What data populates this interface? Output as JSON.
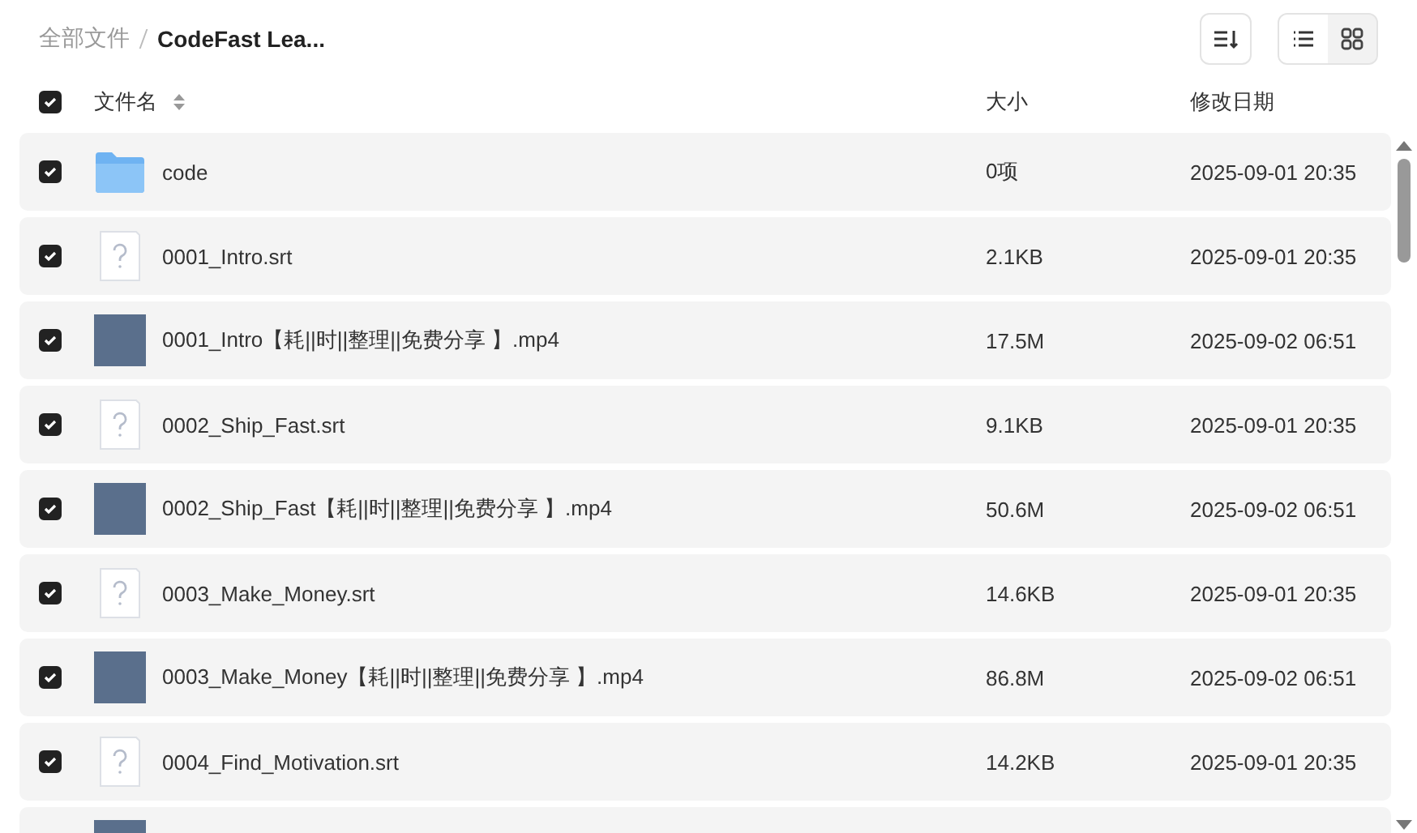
{
  "breadcrumb": [
    {
      "label": "全部文件",
      "current": false
    },
    {
      "label": "CodeFast Lea...",
      "current": true
    }
  ],
  "view_toggle": [
    {
      "kind": "list",
      "selected": true
    },
    {
      "kind": "grid",
      "selected": false
    }
  ],
  "table": {
    "select_all": {
      "checked": true
    },
    "columns": [
      "文件名",
      "大小",
      "修改日期"
    ],
    "rows": [
      {
        "kind": "folder",
        "checked": true,
        "name": "code",
        "size": "0项",
        "date": "2025-09-01 20:35"
      },
      {
        "kind": "unknown",
        "checked": true,
        "name": "0001_Intro.srt",
        "size": "2.1KB",
        "date": "2025-09-01 20:35"
      },
      {
        "kind": "video",
        "checked": true,
        "name": "0001_Intro【耗||时||整理||免费分享 】.mp4",
        "size": "17.5M",
        "date": "2025-09-02 06:51"
      },
      {
        "kind": "unknown",
        "checked": true,
        "name": "0002_Ship_Fast.srt",
        "size": "9.1KB",
        "date": "2025-09-01 20:35"
      },
      {
        "kind": "video",
        "checked": true,
        "name": "0002_Ship_Fast【耗||时||整理||免费分享 】.mp4",
        "size": "50.6M",
        "date": "2025-09-02 06:51"
      },
      {
        "kind": "unknown",
        "checked": true,
        "name": "0003_Make_Money.srt",
        "size": "14.6KB",
        "date": "2025-09-01 20:35"
      },
      {
        "kind": "video",
        "checked": true,
        "name": "0003_Make_Money【耗||时||整理||免费分享 】.mp4",
        "size": "86.8M",
        "date": "2025-09-02 06:51"
      },
      {
        "kind": "unknown",
        "checked": true,
        "name": "0004_Find_Motivation.srt",
        "size": "14.2KB",
        "date": "2025-09-01 20:35"
      },
      {
        "kind": "video"
      }
    ]
  }
}
